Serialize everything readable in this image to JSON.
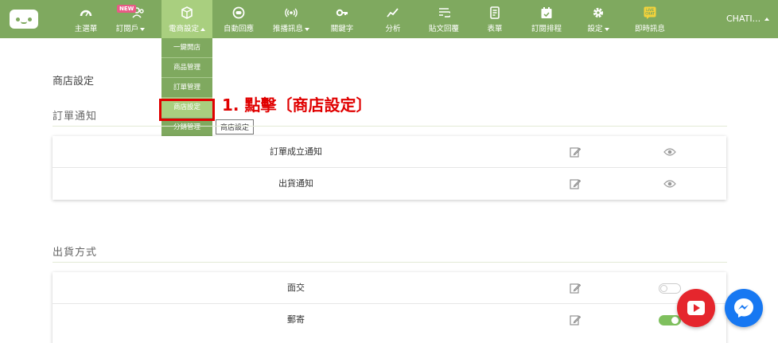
{
  "nav": {
    "items": [
      {
        "label": "主選單",
        "icon": "dashboard-icon"
      },
      {
        "label": "訂閱戶",
        "icon": "users-icon",
        "badge": "NEW",
        "caret": true
      },
      {
        "label": "電商設定",
        "icon": "box-icon",
        "caret": true,
        "active": true
      },
      {
        "label": "自動回應",
        "icon": "robot-icon"
      },
      {
        "label": "推播訊息",
        "icon": "broadcast-icon",
        "caret": true
      },
      {
        "label": "關鍵字",
        "icon": "key-icon"
      },
      {
        "label": "分析",
        "icon": "chart-icon"
      },
      {
        "label": "貼文回覆",
        "icon": "post-reply-icon"
      },
      {
        "label": "表單",
        "icon": "form-icon"
      },
      {
        "label": "訂閱排程",
        "icon": "calendar-icon"
      },
      {
        "label": "設定",
        "icon": "gear-icon",
        "caret": true
      },
      {
        "label": "即時訊息",
        "icon": "live-chat-icon",
        "icon_text": "LIVE CHAT"
      }
    ],
    "user_name": "CHATI..."
  },
  "dropdown": {
    "items": [
      "一鍵開店",
      "商品管理",
      "訂單管理",
      "商店設定",
      "分銷管理"
    ],
    "highlighted_index": 3
  },
  "tooltip": "商店設定",
  "annotation": "1. 點擊〔商店設定〕",
  "page_title": "商店設定",
  "sections": [
    {
      "title": "訂單通知",
      "rows": [
        {
          "label": "訂單成立通知",
          "action": "eye"
        },
        {
          "label": "出貨通知",
          "action": "eye"
        }
      ]
    },
    {
      "title": "出貨方式",
      "rows": [
        {
          "label": "面交",
          "action": "toggle",
          "enabled": false
        },
        {
          "label": "郵寄",
          "action": "toggle",
          "enabled": true
        }
      ]
    }
  ],
  "colors": {
    "nav_bg": "#7fa95f",
    "nav_active": "#a9cf7f",
    "annotation_red": "#e00000",
    "toggle_on": "#7fc05e",
    "youtube_red": "#e5262d",
    "messenger_blue": "#1778f2"
  }
}
